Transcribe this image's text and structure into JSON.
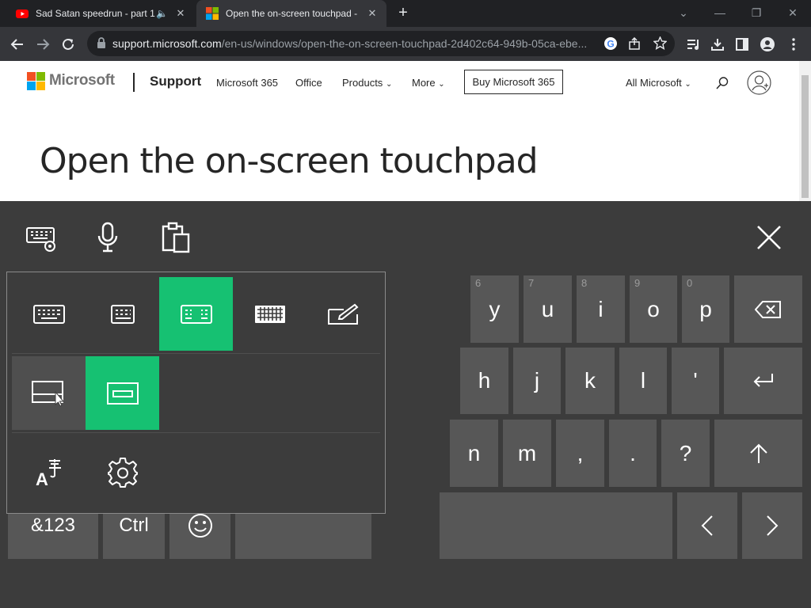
{
  "browser": {
    "tabs": [
      {
        "title": "Sad Satan speedrun - part 1",
        "active": false,
        "icon": "youtube-icon"
      },
      {
        "title": "Open the on-screen touchpad -",
        "active": true,
        "icon": "microsoft-icon"
      }
    ],
    "url_host": "support.microsoft.com",
    "url_path": "/en-us/windows/open-the-on-screen-touchpad-2d402c64-949b-05ca-ebe..."
  },
  "site": {
    "brand": "Microsoft",
    "section": "Support",
    "nav": [
      "Microsoft 365",
      "Office",
      "Products",
      "More"
    ],
    "buy_label": "Buy Microsoft 365",
    "all_microsoft": "All Microsoft",
    "page_title": "Open the on-screen touchpad"
  },
  "keyboard": {
    "row1": [
      {
        "label": "y",
        "num": "6"
      },
      {
        "label": "u",
        "num": "7"
      },
      {
        "label": "i",
        "num": "8"
      },
      {
        "label": "o",
        "num": "9"
      },
      {
        "label": "p",
        "num": "0"
      }
    ],
    "row2": [
      "h",
      "j",
      "k",
      "l",
      "'"
    ],
    "row3": [
      "n",
      "m",
      ",",
      ".",
      "?"
    ],
    "bottom": {
      "sym": "&123",
      "ctrl": "Ctrl"
    }
  },
  "colors": {
    "accent": "#16c172",
    "key": "#575757",
    "panel": "#3c3c3c"
  }
}
